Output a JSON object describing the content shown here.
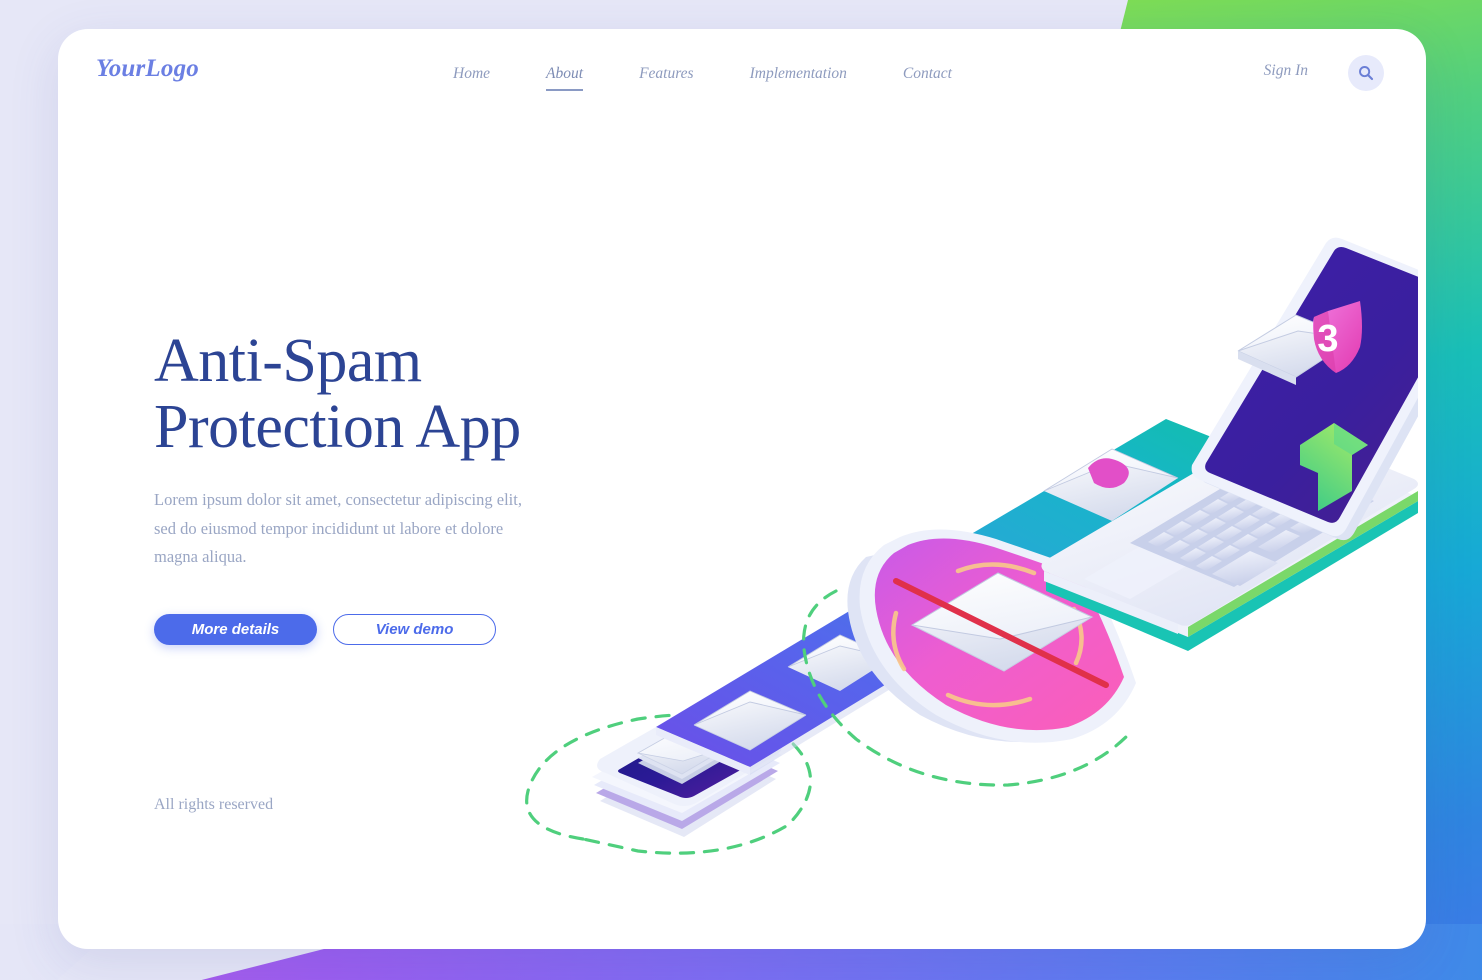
{
  "background": {
    "base_color": "#e6e7f7",
    "accent_gradient": [
      "#8ae04a",
      "#19bfb8",
      "#17a9d6",
      "#3f79e8"
    ],
    "bottom_gradient": [
      "#b45ae8",
      "#7c6ef3",
      "#3f8ae8"
    ]
  },
  "header": {
    "logo": "YourLogo",
    "nav": [
      {
        "label": "Home",
        "active": false
      },
      {
        "label": "About",
        "active": true
      },
      {
        "label": "Features",
        "active": false
      },
      {
        "label": "Implementation",
        "active": false
      },
      {
        "label": "Contact",
        "active": false
      }
    ],
    "signin_label": "Sign In",
    "search_icon": "search-icon"
  },
  "hero": {
    "title_line1": "Anti-Spam",
    "title_line2": "Protection App",
    "title_color": "#2c4494",
    "subtitle": "Lorem ipsum dolor sit amet, consectetur adipiscing elit, sed do eiusmod tempor incididunt ut labore et dolore magna aliqua.",
    "primary_button": "More details",
    "secondary_button": "View demo",
    "primary_color": "#4c6bea"
  },
  "footer": {
    "rights": "All rights reserved"
  },
  "illustration": {
    "name": "isometric-anti-spam-scene",
    "laptop": {
      "screen_color": "#3a1f9e",
      "envelope_icon": "envelope-icon",
      "shield_badge_icon": "shield-badge-icon",
      "shield_badge_count": "3",
      "shield_badge_color": "#e858c8",
      "arrow_icon": "up-arrow-icon",
      "arrow_color": "#4fd27f"
    },
    "conveyor": {
      "start_color": "#5f4fe0",
      "end_color": "#12b3c8",
      "envelope_count": 4
    },
    "shield": {
      "name": "spam-block-shield",
      "color": "#ef5fd0",
      "slash_color": "#e0304a",
      "blocked_envelope_icon": "envelope-icon"
    },
    "tray": {
      "name": "inbox-tray",
      "surface_color": "#2a1a8c",
      "dashed_outline_color": "#4fcf7d"
    }
  }
}
